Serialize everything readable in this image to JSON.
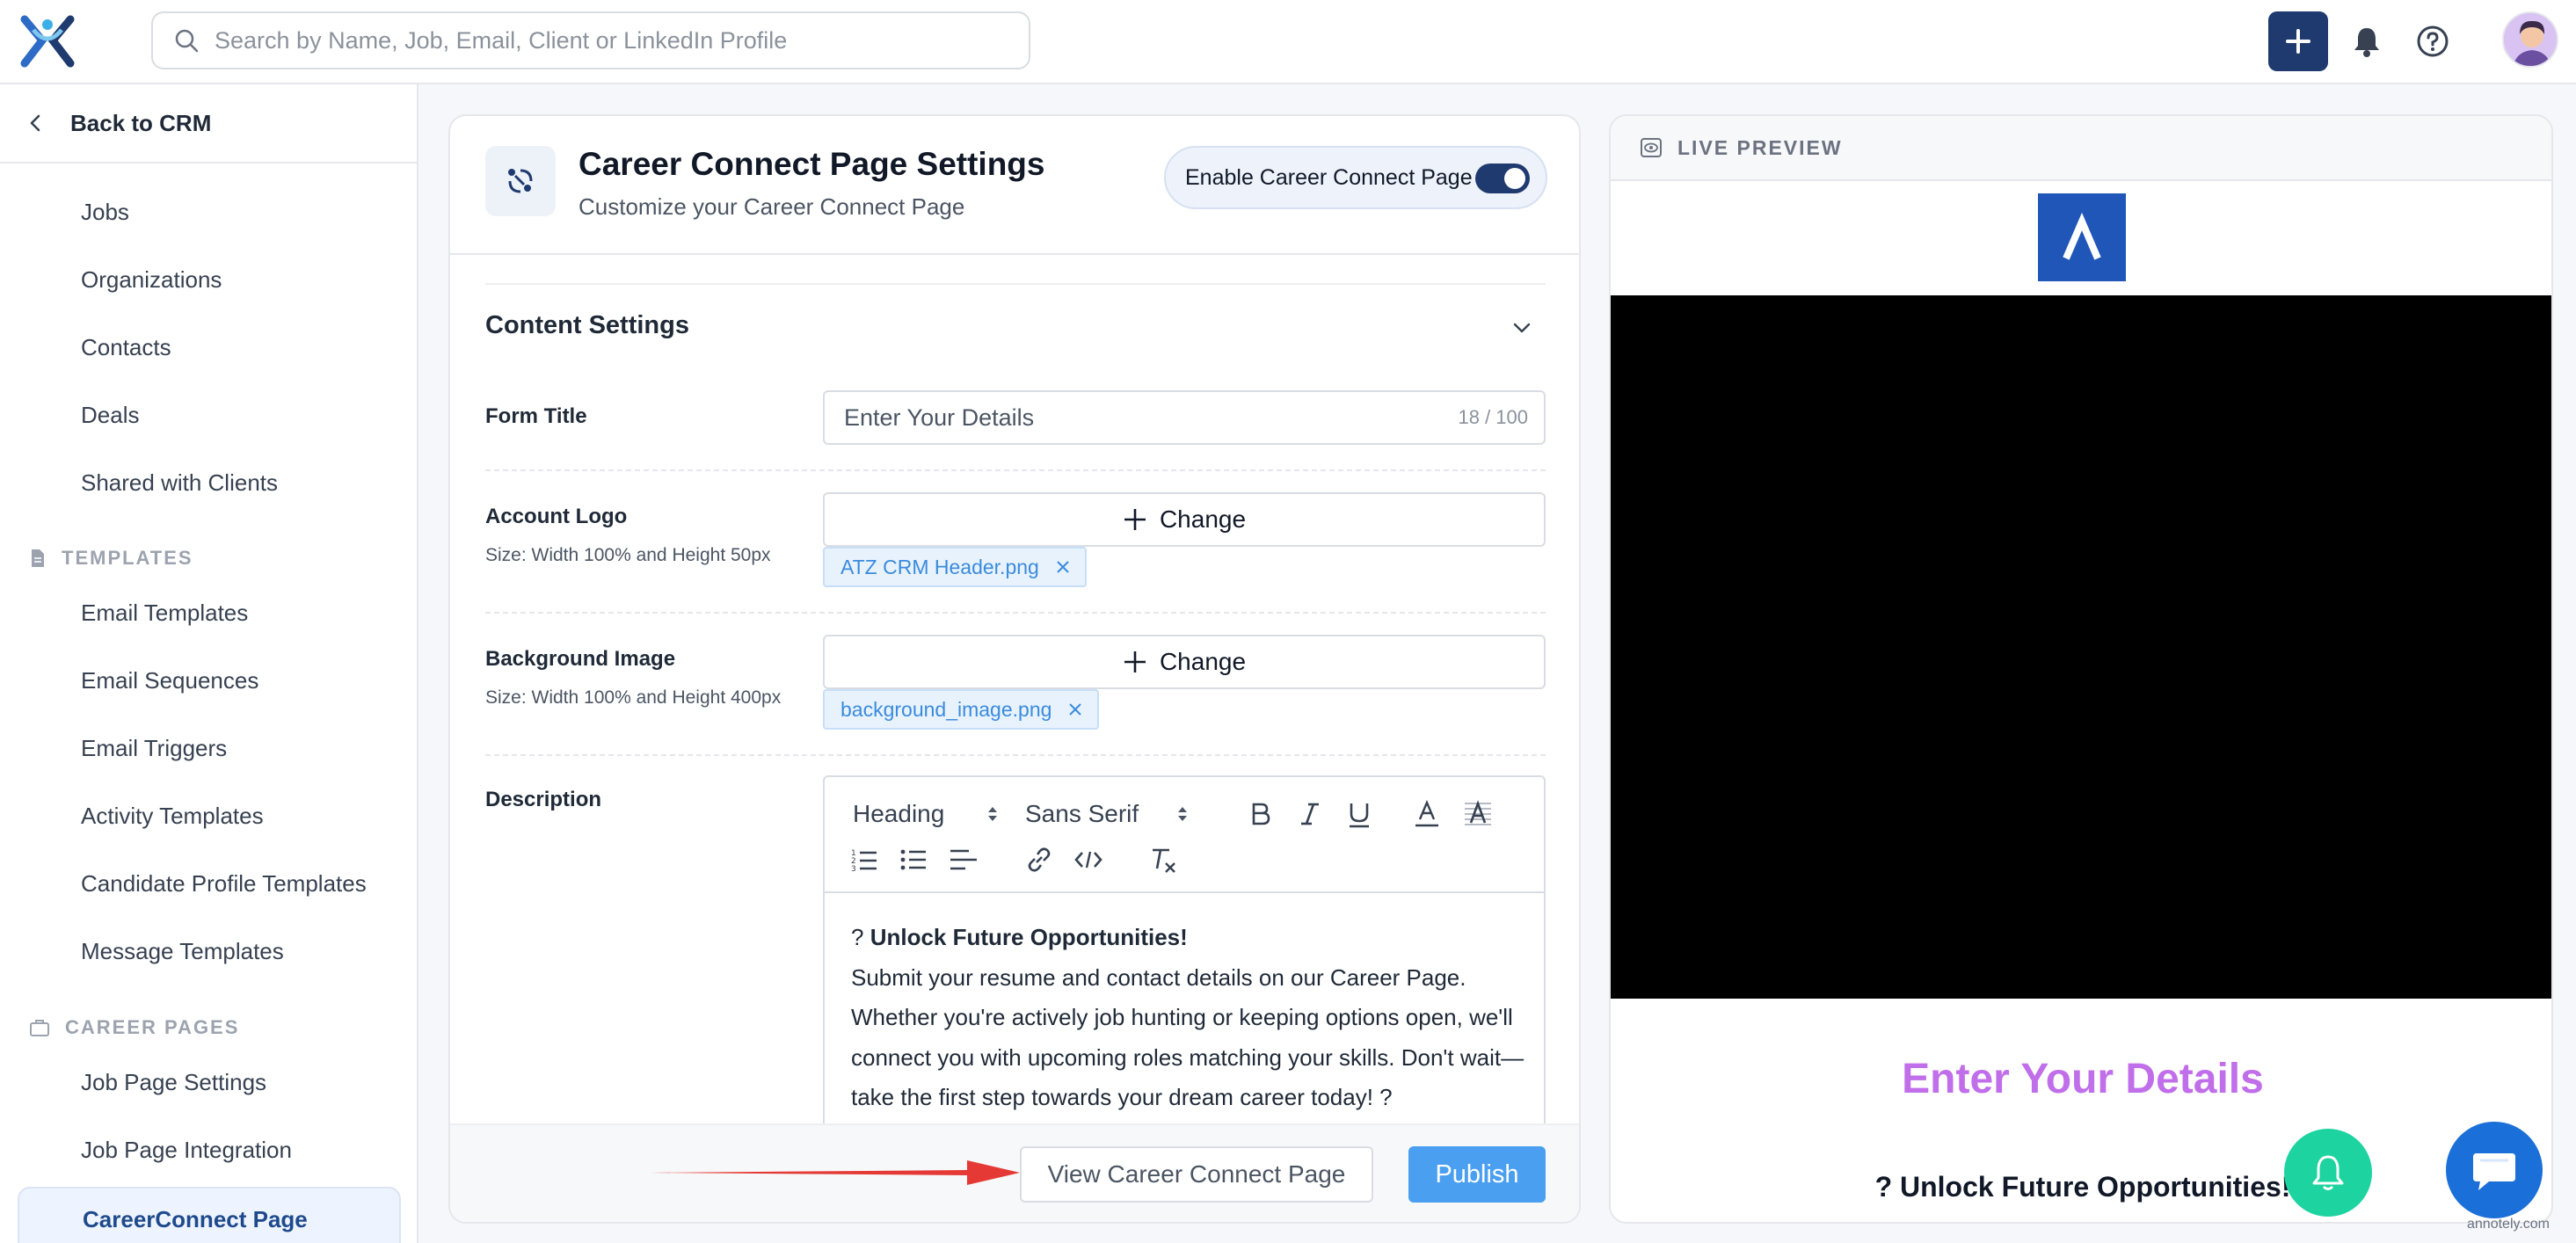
{
  "topbar": {
    "search_placeholder": "Search by Name, Job, Email, Client or LinkedIn Profile"
  },
  "sidebar": {
    "back_label": "Back to CRM",
    "items": [
      "Jobs",
      "Organizations",
      "Contacts",
      "Deals",
      "Shared with Clients"
    ],
    "templates_header": "TEMPLATES",
    "template_items": [
      "Email Templates",
      "Email Sequences",
      "Email Triggers",
      "Activity Templates",
      "Candidate Profile Templates",
      "Message Templates"
    ],
    "career_header": "CAREER PAGES",
    "career_items": [
      "Job Page Settings",
      "Job Page Integration"
    ],
    "active_item": "CareerConnect Page"
  },
  "settings": {
    "title": "Career Connect Page Settings",
    "subtitle": "Customize your Career Connect Page",
    "enable_label": "Enable Career Connect Page",
    "enabled": true,
    "content_section": "Content Settings",
    "form_title_label": "Form Title",
    "form_title_value": "Enter Your Details",
    "form_title_count": "18 / 100",
    "logo_label": "Account Logo",
    "logo_hint": "Size: Width 100% and Height 50px",
    "change_label": "Change",
    "logo_file": "ATZ CRM Header.png",
    "bg_label": "Background Image",
    "bg_hint": "Size: Width 100% and Height 400px",
    "bg_file": "background_image.png",
    "description_label": "Description",
    "editor": {
      "heading_select": "Heading",
      "font_select": "Sans Serif",
      "line1_prefix": "? ",
      "line1_bold": "Unlock Future Opportunities!",
      "body": "Submit your resume and contact details on our Career Page. Whether you're actively job hunting or keeping options open, we'll connect you with upcoming roles matching your skills. Don't wait—take the first step towards your dream career today! ?"
    },
    "view_button": "View Career Connect Page",
    "publish_button": "Publish"
  },
  "preview": {
    "header": "LIVE PREVIEW",
    "form_title": "Enter Your Details",
    "sub_prefix": "? ",
    "sub_bold": "Unlock Future Opportunities!"
  },
  "watermark": "annotely.com",
  "colors": {
    "brand_navy": "#1f3a6e",
    "publish_blue": "#4a9ff0",
    "preview_title": "#c06ee9",
    "fab_green": "#1dd3a0",
    "fab_blue": "#1b6fd8",
    "arrow_red": "#e53935"
  }
}
